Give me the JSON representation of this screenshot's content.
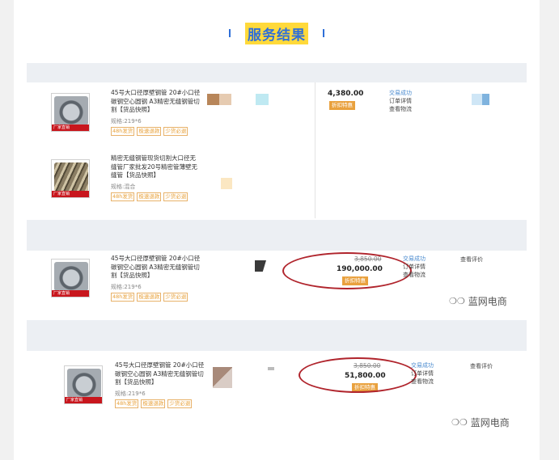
{
  "header": {
    "title": "服务结果"
  },
  "watermark": {
    "text": "蓝网电商",
    "icon": "wechat-icon"
  },
  "panel1": {
    "items": [
      {
        "thumb_label": "厂家直销",
        "thumb": "machine",
        "title": "45号大口径厚壁钢管 20#小口径碳钢空心圆钢 A3精密无缝钢管切割【货品快照】",
        "spec": "规格:219*6",
        "tags": [
          "48h发货",
          "极速退款",
          "少货必退"
        ]
      },
      {
        "thumb_label": "厂家直销",
        "thumb": "pipes",
        "title": "精密无缝钢管现货切割大口径无缝管厂家批发20号精密管薄壁无缝管【货品快照】",
        "spec": "规格:混合",
        "tags": [
          "48h发货",
          "极速退款",
          "少货必退"
        ]
      }
    ],
    "price": "4,380.00",
    "badge": "折扣特惠",
    "status": [
      "交易成功",
      "订单详情",
      "查看物流"
    ]
  },
  "panel2": {
    "item": {
      "thumb_label": "厂家直销",
      "thumb": "machine",
      "title": "45号大口径厚壁钢管 20#小口径碳钢空心圆钢 A3精密无缝钢管切割【货品快照】",
      "spec": "规格:219*6",
      "tags": [
        "48h发货",
        "极速退款",
        "少货必退"
      ]
    },
    "old_price": "3,850.00",
    "price": "190,000.00",
    "badge": "折扣特惠",
    "status": [
      "交易成功",
      "订单详情",
      "查看物流"
    ],
    "review": "查看评价"
  },
  "panel3": {
    "item": {
      "thumb_label": "厂家直销",
      "thumb": "machine",
      "title": "45号大口径厚壁钢管 20#小口径碳钢空心圆钢 A3精密无缝钢管切割【货品快照】",
      "spec": "规格:219*6",
      "tags": [
        "48h发货",
        "极速退款",
        "少货必退"
      ]
    },
    "old_price": "3,850.00",
    "price": "51,800.00",
    "badge": "折扣特惠",
    "status": [
      "交易成功",
      "订单详情",
      "查看物流"
    ],
    "review": "查看评价"
  },
  "colors": {
    "accent": "#2f6fd8",
    "highlight": "#ffd93a",
    "circle": "#b0242c",
    "tag": "#e8a13a"
  }
}
